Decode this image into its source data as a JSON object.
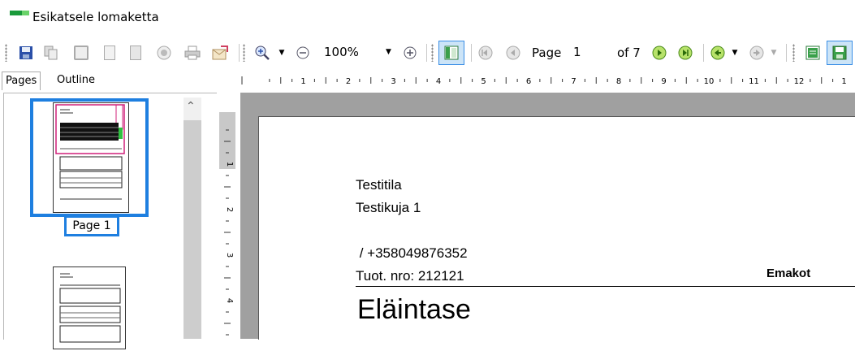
{
  "window": {
    "title": "Esikatsele lomaketta"
  },
  "toolbar": {
    "zoom_value": "100%",
    "page_label": "Page",
    "page_value": "1",
    "of_label": "of 7",
    "icons": [
      "save-icon",
      "copy-icon",
      "single-page-icon",
      "page-icon",
      "page-setup-icon",
      "stop-icon",
      "print-icon",
      "export-icon",
      "zoom-in-icon",
      "zoom-out-icon",
      "zoom-plus-icon",
      "thumbnails-icon",
      "first-page-icon",
      "prev-page-icon",
      "next-page-icon",
      "last-page-icon",
      "back-icon",
      "forward-icon",
      "view-icon",
      "save-view-icon"
    ]
  },
  "sidebar": {
    "tabs": [
      {
        "label": "Pages"
      },
      {
        "label": "Outline"
      }
    ],
    "thumbnails": [
      {
        "label": "Page 1"
      }
    ]
  },
  "ruler": {
    "labels": [
      "1",
      "2",
      "3",
      "4",
      "5",
      "6",
      "7",
      "8",
      "9",
      "10",
      "11",
      "12",
      "1"
    ]
  },
  "vruler": {
    "labels": [
      "1",
      "2",
      "3",
      "4"
    ]
  },
  "document": {
    "line1": "Testitila",
    "line2": "Testikuja 1",
    "phone": " / +358049876352",
    "product": "Tuot. nro: 212121",
    "right_label": "Emakot",
    "heading": "Eläintase"
  },
  "colors": {
    "selection": "#1e7fe0",
    "accent_green": "#1a9a3a"
  }
}
